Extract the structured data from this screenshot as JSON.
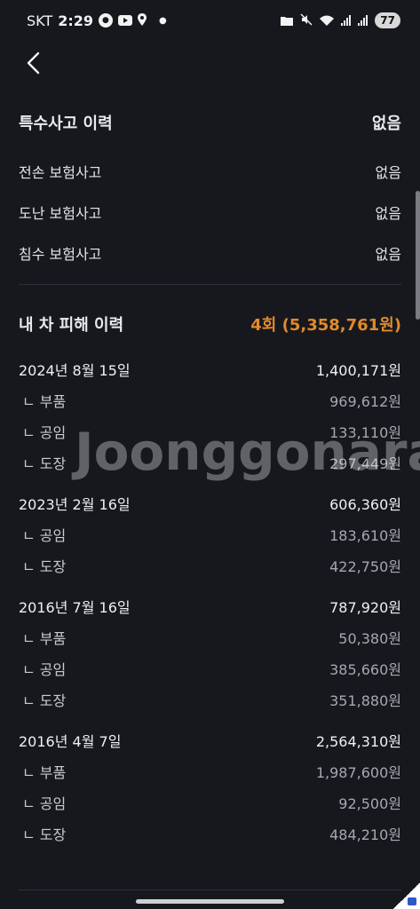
{
  "status": {
    "carrier": "SKT",
    "time": "2:29",
    "battery": "77",
    "icons": [
      "news-icon",
      "youtube-icon",
      "location-icon",
      "dot-icon",
      "folder-icon",
      "mute-icon",
      "wifi-icon",
      "signal-icon",
      "signal-icon"
    ]
  },
  "special_accidents": {
    "title": "특수사고 이력",
    "summary": "없음",
    "items": [
      {
        "label": "전손 보험사고",
        "value": "없음"
      },
      {
        "label": "도난 보험사고",
        "value": "없음"
      },
      {
        "label": "침수 보험사고",
        "value": "없음"
      }
    ]
  },
  "damage_history": {
    "title": "내 차 피해 이력",
    "summary": "4회 (5,358,761원)",
    "colors": {
      "accent": "#e08a2c"
    },
    "records": [
      {
        "date": "2024년 8월 15일",
        "total": "1,400,171원",
        "items": [
          {
            "label": "ㄴ 부품",
            "value": "969,612원"
          },
          {
            "label": "ㄴ 공임",
            "value": "133,110원"
          },
          {
            "label": "ㄴ 도장",
            "value": "297,449원"
          }
        ]
      },
      {
        "date": "2023년 2월 16일",
        "total": "606,360원",
        "items": [
          {
            "label": "ㄴ 공임",
            "value": "183,610원"
          },
          {
            "label": "ㄴ 도장",
            "value": "422,750원"
          }
        ]
      },
      {
        "date": "2016년 7월 16일",
        "total": "787,920원",
        "items": [
          {
            "label": "ㄴ 부품",
            "value": "50,380원"
          },
          {
            "label": "ㄴ 공임",
            "value": "385,660원"
          },
          {
            "label": "ㄴ 도장",
            "value": "351,880원"
          }
        ]
      },
      {
        "date": "2016년 4월 7일",
        "total": "2,564,310원",
        "items": [
          {
            "label": "ㄴ 부품",
            "value": "1,987,600원"
          },
          {
            "label": "ㄴ 공임",
            "value": "92,500원"
          },
          {
            "label": "ㄴ 도장",
            "value": "484,210원"
          }
        ]
      }
    ]
  },
  "watermark": "Joonggonara"
}
